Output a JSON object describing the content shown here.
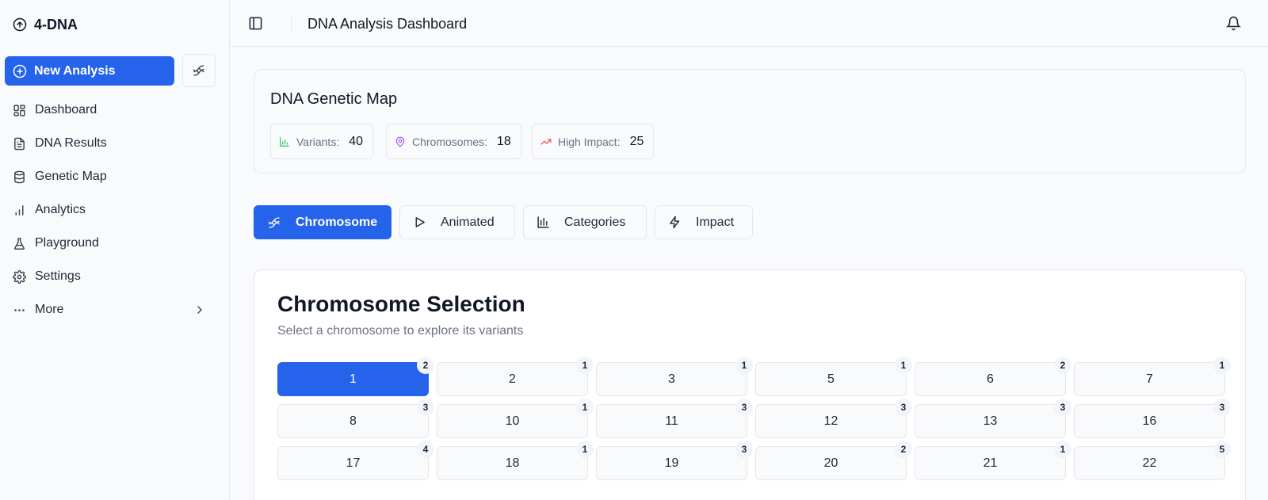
{
  "brand": {
    "name": "4-DNA",
    "icon": "circle-arrow-up-icon"
  },
  "sidebar": {
    "new_button": "New Analysis",
    "items": [
      {
        "label": "Dashboard",
        "icon": "dashboard-grid-icon"
      },
      {
        "label": "DNA Results",
        "icon": "document-icon"
      },
      {
        "label": "Genetic Map",
        "icon": "database-icon"
      },
      {
        "label": "Analytics",
        "icon": "bar-chart-icon"
      },
      {
        "label": "Playground",
        "icon": "flask-icon"
      },
      {
        "label": "Settings",
        "icon": "gear-icon"
      },
      {
        "label": "More",
        "icon": "ellipsis-icon"
      }
    ]
  },
  "topbar": {
    "title": "DNA Analysis Dashboard"
  },
  "map": {
    "title": "DNA Genetic Map",
    "stats": [
      {
        "label": "Variants:",
        "value": "40",
        "color": "#22c55e"
      },
      {
        "label": "Chromosomes:",
        "value": "18",
        "color": "#a855f7"
      },
      {
        "label": "High Impact:",
        "value": "25",
        "color": "#ef4444"
      }
    ]
  },
  "tabs": [
    {
      "label": "Chromosome",
      "active": true
    },
    {
      "label": "Animated",
      "active": false
    },
    {
      "label": "Categories",
      "active": false
    },
    {
      "label": "Impact",
      "active": false
    }
  ],
  "selection": {
    "title": "Chromosome Selection",
    "subtitle": "Select a chromosome to explore its variants",
    "selected": "1",
    "chromosomes": [
      {
        "label": "1",
        "count": "2"
      },
      {
        "label": "2",
        "count": "1"
      },
      {
        "label": "3",
        "count": "1"
      },
      {
        "label": "5",
        "count": "1"
      },
      {
        "label": "6",
        "count": "2"
      },
      {
        "label": "7",
        "count": "1"
      },
      {
        "label": "8",
        "count": "3"
      },
      {
        "label": "10",
        "count": "1"
      },
      {
        "label": "11",
        "count": "3"
      },
      {
        "label": "12",
        "count": "3"
      },
      {
        "label": "13",
        "count": "3"
      },
      {
        "label": "16",
        "count": "3"
      },
      {
        "label": "17",
        "count": "4"
      },
      {
        "label": "18",
        "count": "1"
      },
      {
        "label": "19",
        "count": "3"
      },
      {
        "label": "20",
        "count": "2"
      },
      {
        "label": "21",
        "count": "1"
      },
      {
        "label": "22",
        "count": "5"
      }
    ]
  },
  "colors": {
    "accent": "#2563eb",
    "border": "#e5e7eb",
    "muted": "#6b7280"
  }
}
